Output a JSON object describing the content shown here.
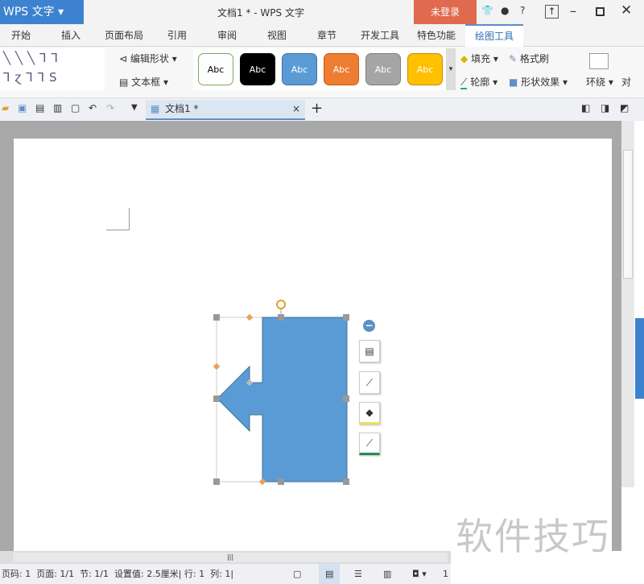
{
  "titlebar": {
    "app_name": "WPS 文字",
    "title": "文档1 * - WPS 文字",
    "login": "未登录",
    "help": "?"
  },
  "tabs": [
    "开始",
    "插入",
    "页面布局",
    "引用",
    "审阅",
    "视图",
    "章节",
    "开发工具",
    "特色功能",
    "绘图工具"
  ],
  "ribbon": {
    "edit_shape": "编辑形状",
    "textbox": "文本框",
    "styles": [
      {
        "label": "Abc",
        "bg": "#ffffff",
        "fg": "#000000",
        "border": "#7aa85a"
      },
      {
        "label": "Abc",
        "bg": "#000000",
        "fg": "#ffffff",
        "border": "#000000"
      },
      {
        "label": "Abc",
        "bg": "#5b9bd5",
        "fg": "#ffffff",
        "border": "#41719c"
      },
      {
        "label": "Abc",
        "bg": "#ed7d31",
        "fg": "#ffffff",
        "border": "#c55a11"
      },
      {
        "label": "Abc",
        "bg": "#a5a5a5",
        "fg": "#ffffff",
        "border": "#7f7f7f"
      },
      {
        "label": "Abc",
        "bg": "#ffc000",
        "fg": "#ffffff",
        "border": "#bf9000"
      }
    ],
    "fill": "填充",
    "format_painter": "格式刷",
    "outline": "轮廓",
    "shape_effect": "形状效果",
    "wrap": "环绕",
    "align": "对"
  },
  "doc_tab": {
    "name": "文档1 *"
  },
  "shape": {
    "fill": "#5b9bd5",
    "stroke": "#41719c"
  },
  "status": {
    "page_num": "页码: 1",
    "pages": "页面: 1/1",
    "section": "节: 1/1",
    "setting": "设置值: 2.5厘米",
    "row": "行: 1",
    "col": "列: 1",
    "zoom": "1"
  },
  "watermark": "软件技巧"
}
